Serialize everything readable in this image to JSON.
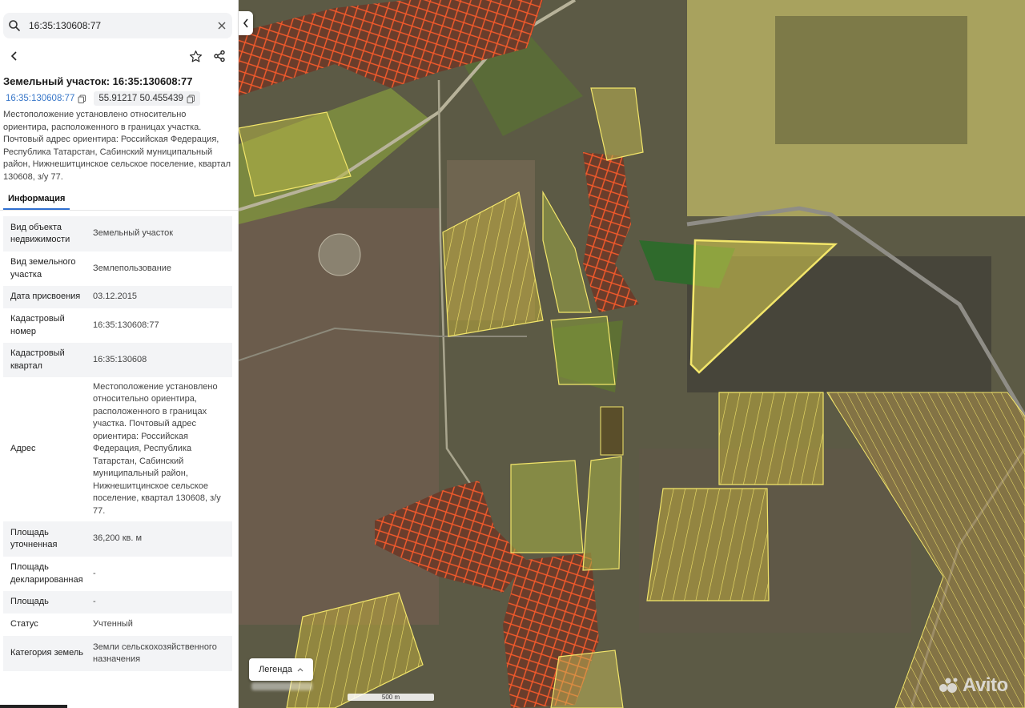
{
  "search": {
    "value": "16:35:130608:77"
  },
  "object": {
    "title": "Земельный участок: 16:35:130608:77",
    "cadastral_link": "16:35:130608:77",
    "coordinates": "55.91217 50.455439",
    "description": "Местоположение установлено относительно ориентира, расположенного в границах участка. Почтовый адрес ориентира: Российская Федерация, Республика Татарстан, Сабинский муниципальный район, Нижнешитцинское сельское поселение, квартал 130608, з/у 77."
  },
  "tabs": {
    "info": "Информация"
  },
  "info_rows": [
    {
      "key": "Вид объекта недвижимости",
      "value": "Земельный участок"
    },
    {
      "key": "Вид земельного участка",
      "value": "Землепользование"
    },
    {
      "key": "Дата присвоения",
      "value": "03.12.2015"
    },
    {
      "key": "Кадастровый номер",
      "value": "16:35:130608:77"
    },
    {
      "key": "Кадастровый квартал",
      "value": "16:35:130608"
    },
    {
      "key": "Адрес",
      "value": "Местоположение установлено относительно ориентира, расположенного в границах участка. Почтовый адрес ориентира: Российская Федерация, Республика Татарстан, Сабинский муниципальный район, Нижнешитцинское сельское поселение, квартал 130608, з/у 77."
    },
    {
      "key": "Площадь уточненная",
      "value": "36,200 кв. м"
    },
    {
      "key": "Площадь декларированная",
      "value": "-"
    },
    {
      "key": "Площадь",
      "value": "-"
    },
    {
      "key": "Статус",
      "value": "Учтенный"
    },
    {
      "key": "Категория земель",
      "value": "Земли сельскохозяйственного назначения"
    }
  ],
  "map": {
    "legend_label": "Легенда",
    "scale_label": "500 m",
    "watermark": "Avito"
  },
  "colors": {
    "accent_link": "#3a78c9",
    "tab_underline": "#2f6fd0",
    "parcel_red": "#ff5a2a",
    "parcel_yellow": "#f3e66a"
  },
  "icons": {
    "search": "search-icon",
    "clear": "close-icon",
    "back": "chevron-left-icon",
    "favorite": "star-icon",
    "share": "share-icon",
    "copy": "copy-icon",
    "collapse": "chevron-left-icon",
    "legend_toggle": "chevron-up-icon"
  }
}
